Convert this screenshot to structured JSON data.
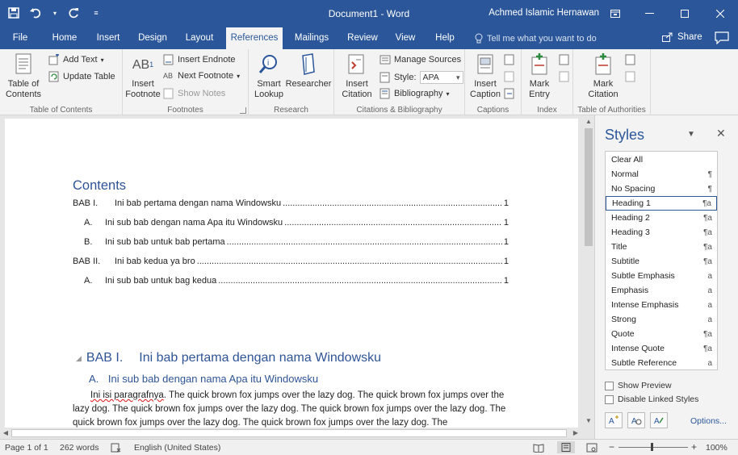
{
  "app": {
    "document_title": "Document1 - Word",
    "user_name": "Achmed Islamic Hernawan"
  },
  "tabs": [
    "File",
    "Home",
    "Insert",
    "Design",
    "Layout",
    "References",
    "Mailings",
    "Review",
    "View",
    "Help"
  ],
  "active_tab": "References",
  "tell_me": "Tell me what you want to do",
  "share": "Share",
  "ribbon": {
    "toc": {
      "table_of_contents": "Table of\nContents",
      "add_text": "Add Text",
      "update_table": "Update Table",
      "label": "Table of Contents"
    },
    "footnotes": {
      "insert_footnote": "Insert\nFootnote",
      "ab_glyph": "AB",
      "insert_endnote": "Insert Endnote",
      "next_footnote": "Next Footnote",
      "show_notes": "Show Notes",
      "label": "Footnotes"
    },
    "research": {
      "smart_lookup": "Smart\nLookup",
      "researcher": "Researcher",
      "label": "Research"
    },
    "citations": {
      "insert_citation": "Insert\nCitation",
      "manage_sources": "Manage Sources",
      "style_label": "Style:",
      "style_value": "APA",
      "bibliography": "Bibliography",
      "label": "Citations & Bibliography"
    },
    "captions": {
      "insert_caption": "Insert\nCaption",
      "label": "Captions"
    },
    "index": {
      "mark_entry": "Mark\nEntry",
      "label": "Index"
    },
    "authorities": {
      "mark_citation": "Mark\nCitation",
      "label": "Table of Authorities"
    }
  },
  "document": {
    "toc_title": "Contents",
    "toc_entries": [
      {
        "num": "BAB I.",
        "text": "Ini bab pertama dengan nama Windowsku",
        "page": "1"
      },
      {
        "num": "A.",
        "text": "Ini sub bab dengan nama Apa itu Windowsku",
        "page": "1"
      },
      {
        "num": "B.",
        "text": "Ini sub bab untuk bab pertama",
        "page": "1"
      },
      {
        "num": "BAB II.",
        "text": "Ini bab kedua ya bro",
        "page": "1"
      },
      {
        "num": "A.",
        "text": "Ini sub bab untuk bag kedua",
        "page": "1"
      }
    ],
    "heading1_num": "BAB I.",
    "heading1_text": "Ini bab pertama dengan nama Windowsku",
    "heading2_num": "A.",
    "heading2_text": "Ini sub bab dengan nama Apa itu Windowsku",
    "body_lead": "Ini isi paragrafnya",
    "body_text": ". The quick brown fox jumps over the lazy dog. The quick brown fox jumps over the lazy dog. The quick brown fox jumps over the lazy dog. The quick brown fox jumps over the lazy dog. The quick brown fox jumps over the lazy dog. The quick brown fox jumps over the lazy dog. The"
  },
  "styles_pane": {
    "title": "Styles",
    "styles": [
      {
        "name": "Clear All",
        "glyph": ""
      },
      {
        "name": "Normal",
        "glyph": "¶"
      },
      {
        "name": "No Spacing",
        "glyph": "¶"
      },
      {
        "name": "Heading 1",
        "glyph": "¶a"
      },
      {
        "name": "Heading 2",
        "glyph": "¶a"
      },
      {
        "name": "Heading 3",
        "glyph": "¶a"
      },
      {
        "name": "Title",
        "glyph": "¶a"
      },
      {
        "name": "Subtitle",
        "glyph": "¶a"
      },
      {
        "name": "Subtle Emphasis",
        "glyph": "a"
      },
      {
        "name": "Emphasis",
        "glyph": "a"
      },
      {
        "name": "Intense Emphasis",
        "glyph": "a"
      },
      {
        "name": "Strong",
        "glyph": "a"
      },
      {
        "name": "Quote",
        "glyph": "¶a"
      },
      {
        "name": "Intense Quote",
        "glyph": "¶a"
      },
      {
        "name": "Subtle Reference",
        "glyph": "a"
      }
    ],
    "selected_style": "Heading 1",
    "show_preview": "Show Preview",
    "disable_linked": "Disable Linked Styles",
    "options": "Options..."
  },
  "status": {
    "page": "Page 1 of 1",
    "words": "262 words",
    "language": "English (United States)",
    "zoom": "100%"
  },
  "colors": {
    "accent": "#2b579a",
    "heading": "#2f5496"
  }
}
